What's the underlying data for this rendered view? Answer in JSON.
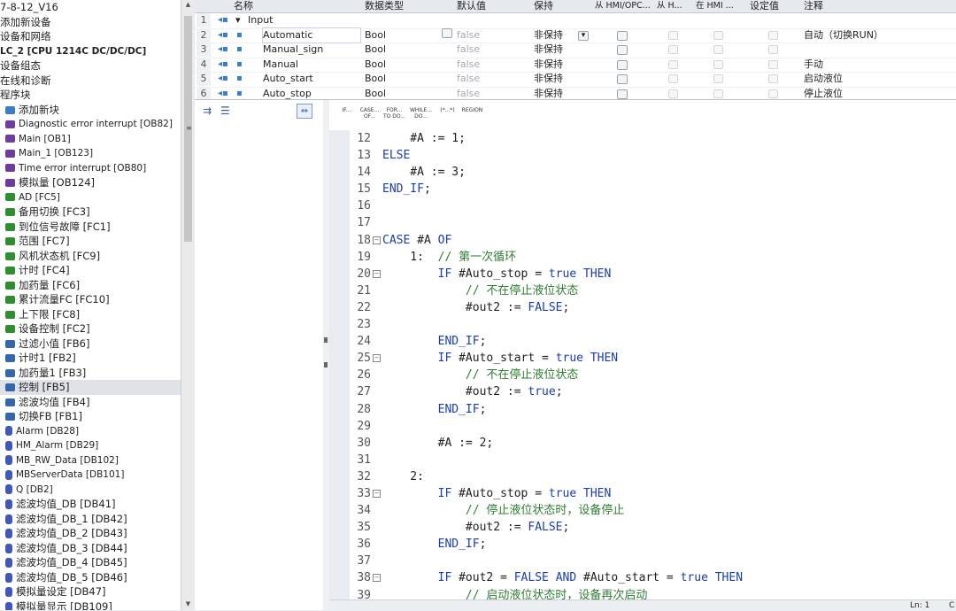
{
  "tree": {
    "items": [
      {
        "label": "7-8-12_V16",
        "icon": "",
        "indent": 0,
        "small": false
      },
      {
        "label": "添加新设备",
        "icon": "",
        "indent": 0,
        "small": false
      },
      {
        "label": "设备和网络",
        "icon": "",
        "indent": 0,
        "small": false
      },
      {
        "label": "LC_2 [CPU 1214C DC/DC/DC]",
        "icon": "",
        "indent": 0,
        "small": true,
        "bold": true
      },
      {
        "label": "设备组态",
        "icon": "",
        "indent": 0,
        "small": false
      },
      {
        "label": "在线和诊断",
        "icon": "",
        "indent": 0,
        "small": false
      },
      {
        "label": "程序块",
        "icon": "",
        "indent": 0,
        "small": false
      },
      {
        "label": "添加新块",
        "icon": "add",
        "indent": 1,
        "small": false
      },
      {
        "label": "Diagnostic error interrupt [OB82]",
        "icon": "purple",
        "indent": 1,
        "small": true
      },
      {
        "label": "Main [OB1]",
        "icon": "purple",
        "indent": 1,
        "small": true
      },
      {
        "label": "Main_1 [OB123]",
        "icon": "purple",
        "indent": 1,
        "small": true
      },
      {
        "label": "Time error interrupt [OB80]",
        "icon": "purple",
        "indent": 1,
        "small": true
      },
      {
        "label": "模拟量 [OB124]",
        "icon": "purple",
        "indent": 1,
        "small": false
      },
      {
        "label": "AD [FC5]",
        "icon": "green",
        "indent": 1,
        "small": true
      },
      {
        "label": "备用切换 [FC3]",
        "icon": "green",
        "indent": 1,
        "small": false
      },
      {
        "label": "到位信号故障 [FC1]",
        "icon": "green",
        "indent": 1,
        "small": false
      },
      {
        "label": "范围 [FC7]",
        "icon": "green",
        "indent": 1,
        "small": false
      },
      {
        "label": "风机状态机 [FC9]",
        "icon": "green",
        "indent": 1,
        "small": false
      },
      {
        "label": "计时 [FC4]",
        "icon": "green",
        "indent": 1,
        "small": false
      },
      {
        "label": "加药量 [FC6]",
        "icon": "green",
        "indent": 1,
        "small": false
      },
      {
        "label": "累计流量FC [FC10]",
        "icon": "green",
        "indent": 1,
        "small": false
      },
      {
        "label": "上下限 [FC8]",
        "icon": "green",
        "indent": 1,
        "small": false
      },
      {
        "label": "设备控制 [FC2]",
        "icon": "green",
        "indent": 1,
        "small": false
      },
      {
        "label": "过滤小值 [FB6]",
        "icon": "blue",
        "indent": 1,
        "small": false
      },
      {
        "label": "计时1 [FB2]",
        "icon": "blue",
        "indent": 1,
        "small": false
      },
      {
        "label": "加药量1 [FB3]",
        "icon": "blue",
        "indent": 1,
        "small": false
      },
      {
        "label": "控制 [FB5]",
        "icon": "blue",
        "indent": 1,
        "small": false,
        "selected": true
      },
      {
        "label": "滤波均值 [FB4]",
        "icon": "blue",
        "indent": 1,
        "small": false
      },
      {
        "label": "切换FB [FB1]",
        "icon": "blue",
        "indent": 1,
        "small": false
      },
      {
        "label": "Alarm [DB28]",
        "icon": "db",
        "indent": 1,
        "small": true
      },
      {
        "label": "HM_Alarm [DB29]",
        "icon": "db",
        "indent": 1,
        "small": true
      },
      {
        "label": "MB_RW_Data [DB102]",
        "icon": "db",
        "indent": 1,
        "small": true
      },
      {
        "label": "MBServerData [DB101]",
        "icon": "db",
        "indent": 1,
        "small": true
      },
      {
        "label": "Q [DB2]",
        "icon": "db",
        "indent": 1,
        "small": true
      },
      {
        "label": "滤波均值_DB [DB41]",
        "icon": "db",
        "indent": 1,
        "small": false
      },
      {
        "label": "滤波均值_DB_1 [DB42]",
        "icon": "db",
        "indent": 1,
        "small": false
      },
      {
        "label": "滤波均值_DB_2 [DB43]",
        "icon": "db",
        "indent": 1,
        "small": false
      },
      {
        "label": "滤波均值_DB_3 [DB44]",
        "icon": "db",
        "indent": 1,
        "small": false
      },
      {
        "label": "滤波均值_DB_4 [DB45]",
        "icon": "db",
        "indent": 1,
        "small": false
      },
      {
        "label": "滤波均值_DB_5 [DB46]",
        "icon": "db",
        "indent": 1,
        "small": false
      },
      {
        "label": "模拟量设定 [DB47]",
        "icon": "db",
        "indent": 1,
        "small": false
      },
      {
        "label": "模拟量显示 [DB109]",
        "icon": "db",
        "indent": 1,
        "small": false
      }
    ]
  },
  "interface": {
    "headers": {
      "name": "名称",
      "datatype": "数据类型",
      "default": "默认值",
      "retain": "保持",
      "from_hmi": "从 HMI/OPC...",
      "from_h": "从 H...",
      "in_hmi": "在 HMI ...",
      "setpoint": "设定值",
      "comment": "注释"
    },
    "rows": [
      {
        "num": "1",
        "name": "Input",
        "type": "",
        "default": "",
        "retain": "",
        "comment": "",
        "section": true
      },
      {
        "num": "2",
        "name": "Automatic",
        "type": "Bool",
        "default": "false",
        "retain": "非保持",
        "comment": "自动（切换RUN）",
        "active": true
      },
      {
        "num": "3",
        "name": "Manual_sign",
        "type": "Bool",
        "default": "false",
        "retain": "非保持",
        "comment": ""
      },
      {
        "num": "4",
        "name": "Manual",
        "type": "Bool",
        "default": "false",
        "retain": "非保持",
        "comment": "手动"
      },
      {
        "num": "5",
        "name": "Auto_start",
        "type": "Bool",
        "default": "false",
        "retain": "非保持",
        "comment": "启动液位"
      },
      {
        "num": "6",
        "name": "Auto_stop",
        "type": "Bool",
        "default": "false",
        "retain": "非保持",
        "comment": "停止液位"
      }
    ]
  },
  "toolbar": {
    "buttons": [
      "IF...",
      "CASE... OF...",
      "FOR... TO DO...",
      "WHILE... DO...",
      "(*...*)",
      "REGION"
    ]
  },
  "editor": {
    "lines": [
      {
        "n": "12",
        "fold": "",
        "segs": [
          [
            "    #A := 1;",
            "var"
          ]
        ]
      },
      {
        "n": "13",
        "fold": "",
        "segs": [
          [
            "ELSE",
            "kw"
          ]
        ]
      },
      {
        "n": "14",
        "fold": "",
        "segs": [
          [
            "    #A := 3;",
            "var"
          ]
        ]
      },
      {
        "n": "15",
        "fold": "",
        "segs": [
          [
            "END_IF",
            "kw"
          ],
          [
            ";",
            "var"
          ]
        ]
      },
      {
        "n": "16",
        "fold": "",
        "segs": [
          [
            "",
            "var"
          ]
        ]
      },
      {
        "n": "17",
        "fold": "",
        "segs": [
          [
            "",
            "var"
          ]
        ]
      },
      {
        "n": "18",
        "fold": "box",
        "segs": [
          [
            "CASE",
            "kw"
          ],
          [
            " #A ",
            "var"
          ],
          [
            "OF",
            "kw"
          ]
        ]
      },
      {
        "n": "19",
        "fold": "",
        "segs": [
          [
            "    1:  ",
            "var"
          ],
          [
            "// 第一次循环",
            "cm"
          ]
        ]
      },
      {
        "n": "20",
        "fold": "box",
        "segs": [
          [
            "        ",
            "var"
          ],
          [
            "IF",
            "kw"
          ],
          [
            " #Auto_stop = ",
            "var"
          ],
          [
            "true",
            "kw"
          ],
          [
            " ",
            "var"
          ],
          [
            "THEN",
            "kw"
          ]
        ]
      },
      {
        "n": "21",
        "fold": "",
        "segs": [
          [
            "            ",
            "var"
          ],
          [
            "// 不在停止液位状态",
            "cm"
          ]
        ]
      },
      {
        "n": "22",
        "fold": "",
        "segs": [
          [
            "            #out2 := ",
            "var"
          ],
          [
            "FALSE",
            "kw"
          ],
          [
            ";",
            "var"
          ]
        ]
      },
      {
        "n": "23",
        "fold": "",
        "segs": [
          [
            "",
            "var"
          ]
        ]
      },
      {
        "n": "24",
        "fold": "",
        "segs": [
          [
            "        ",
            "var"
          ],
          [
            "END_IF",
            "kw"
          ],
          [
            ";",
            "var"
          ]
        ]
      },
      {
        "n": "25",
        "fold": "box",
        "segs": [
          [
            "        ",
            "var"
          ],
          [
            "IF",
            "kw"
          ],
          [
            " #Auto_start = ",
            "var"
          ],
          [
            "true",
            "kw"
          ],
          [
            " ",
            "var"
          ],
          [
            "THEN",
            "kw"
          ]
        ]
      },
      {
        "n": "26",
        "fold": "",
        "segs": [
          [
            "            ",
            "var"
          ],
          [
            "// 不在停止液位状态",
            "cm"
          ]
        ]
      },
      {
        "n": "27",
        "fold": "",
        "segs": [
          [
            "            #out2 := ",
            "var"
          ],
          [
            "true",
            "kw"
          ],
          [
            ";",
            "var"
          ]
        ]
      },
      {
        "n": "28",
        "fold": "",
        "segs": [
          [
            "        ",
            "var"
          ],
          [
            "END_IF",
            "kw"
          ],
          [
            ";",
            "var"
          ]
        ]
      },
      {
        "n": "29",
        "fold": "",
        "segs": [
          [
            "",
            "var"
          ]
        ]
      },
      {
        "n": "30",
        "fold": "",
        "segs": [
          [
            "        #A := 2;",
            "var"
          ]
        ]
      },
      {
        "n": "31",
        "fold": "",
        "segs": [
          [
            "",
            "var"
          ]
        ]
      },
      {
        "n": "32",
        "fold": "",
        "segs": [
          [
            "    2:",
            "var"
          ]
        ]
      },
      {
        "n": "33",
        "fold": "box",
        "segs": [
          [
            "        ",
            "var"
          ],
          [
            "IF",
            "kw"
          ],
          [
            " #Auto_stop = ",
            "var"
          ],
          [
            "true",
            "kw"
          ],
          [
            " ",
            "var"
          ],
          [
            "THEN",
            "kw"
          ]
        ]
      },
      {
        "n": "34",
        "fold": "",
        "segs": [
          [
            "            ",
            "var"
          ],
          [
            "// 停止液位状态时，设备停止",
            "cm"
          ]
        ]
      },
      {
        "n": "35",
        "fold": "",
        "segs": [
          [
            "            #out2 := ",
            "var"
          ],
          [
            "FALSE",
            "kw"
          ],
          [
            ";",
            "var"
          ]
        ]
      },
      {
        "n": "36",
        "fold": "",
        "segs": [
          [
            "        ",
            "var"
          ],
          [
            "END_IF",
            "kw"
          ],
          [
            ";",
            "var"
          ]
        ]
      },
      {
        "n": "37",
        "fold": "",
        "segs": [
          [
            "",
            "var"
          ]
        ]
      },
      {
        "n": "38",
        "fold": "box",
        "segs": [
          [
            "        ",
            "var"
          ],
          [
            "IF",
            "kw"
          ],
          [
            " #out2 = ",
            "var"
          ],
          [
            "FALSE",
            "kw"
          ],
          [
            " ",
            "var"
          ],
          [
            "AND",
            "kw"
          ],
          [
            " #Auto_start = ",
            "var"
          ],
          [
            "true",
            "kw"
          ],
          [
            " ",
            "var"
          ],
          [
            "THEN",
            "kw"
          ]
        ]
      },
      {
        "n": "39",
        "fold": "",
        "segs": [
          [
            "            ",
            "var"
          ],
          [
            "// 启动液位状态时，设备再次启动",
            "cm"
          ]
        ]
      }
    ]
  },
  "status": {
    "position": "Ln: 1",
    "col": "C"
  },
  "colors": {
    "keyword": "#1a3cae",
    "comment": "#2e7d32",
    "text": "#1f1f1f"
  }
}
